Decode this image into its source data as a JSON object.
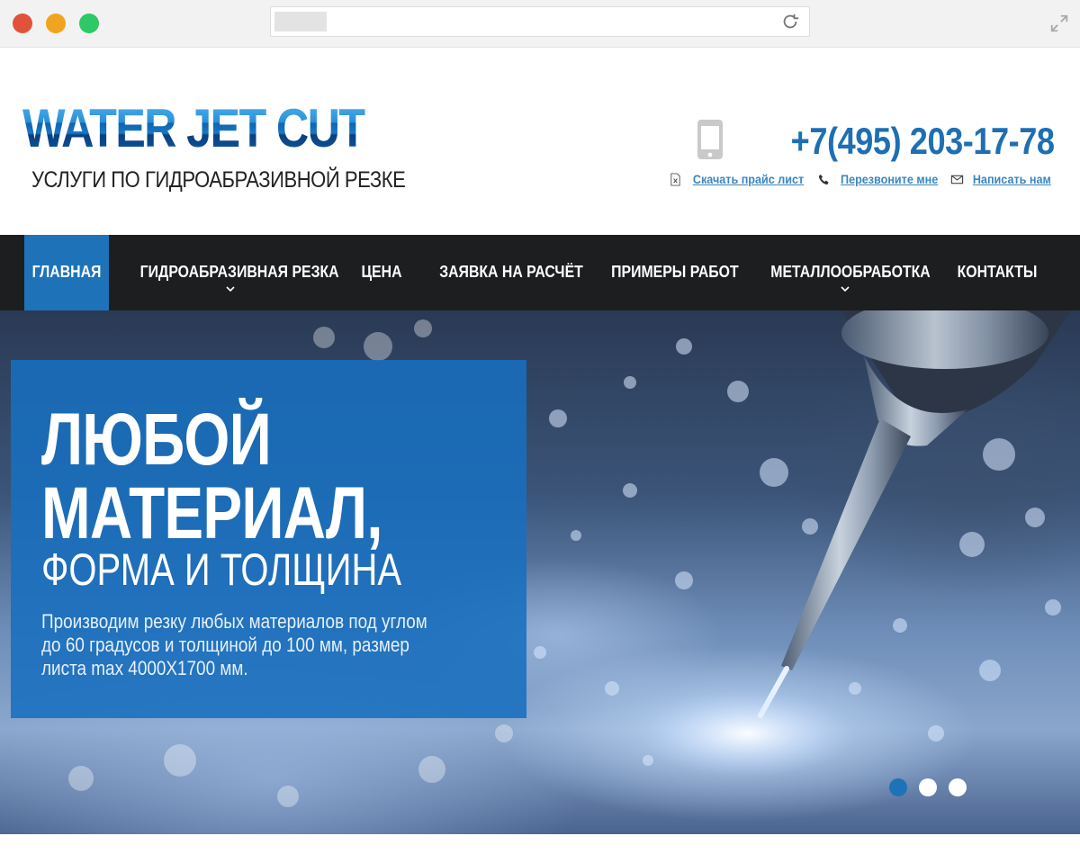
{
  "browser": {
    "icons": [
      "close-dot",
      "minimize-dot",
      "maximize-dot",
      "reload-icon",
      "expand-icon"
    ]
  },
  "header": {
    "logo_title": "WATER JET CUT",
    "logo_subtitle": "УСЛУГИ ПО ГИДРОАБРАЗИВНОЙ РЕЗКЕ",
    "phone": "+7(495) 203-17-78",
    "links": [
      {
        "label": "Скачать прайс лист",
        "icon": "excel-file-icon"
      },
      {
        "label": "Перезвоните мне",
        "icon": "phone-handset-icon"
      },
      {
        "label": "Написать нам",
        "icon": "envelope-icon"
      }
    ]
  },
  "nav": {
    "items": [
      {
        "label": "ГЛАВНАЯ",
        "active": true,
        "dropdown": false
      },
      {
        "label": "ГИДРОАБРАЗИВНАЯ РЕЗКА",
        "active": false,
        "dropdown": true
      },
      {
        "label": "ЦЕНА",
        "active": false,
        "dropdown": false
      },
      {
        "label": "ЗАЯВКА НА РАСЧЁТ",
        "active": false,
        "dropdown": false
      },
      {
        "label": "ПРИМЕРЫ РАБОТ",
        "active": false,
        "dropdown": false
      },
      {
        "label": "МЕТАЛЛООБРАБОТКА",
        "active": false,
        "dropdown": true
      },
      {
        "label": "КОНТАКТЫ",
        "active": false,
        "dropdown": false
      }
    ]
  },
  "hero": {
    "line1": "ЛЮБОЙ",
    "line2": "МАТЕРИАЛ,",
    "line3": "ФОРМА И ТОЛЩИНА",
    "description": "Производим резку любых материалов под углом до 60 градусов и толщиной до 100 мм, размер листа max 4000X1700 мм.",
    "slides_total": 3,
    "active_slide": 1
  },
  "colors": {
    "accent": "#1e73b8",
    "nav_bg": "#1c1e20",
    "link": "#3b86c0"
  }
}
